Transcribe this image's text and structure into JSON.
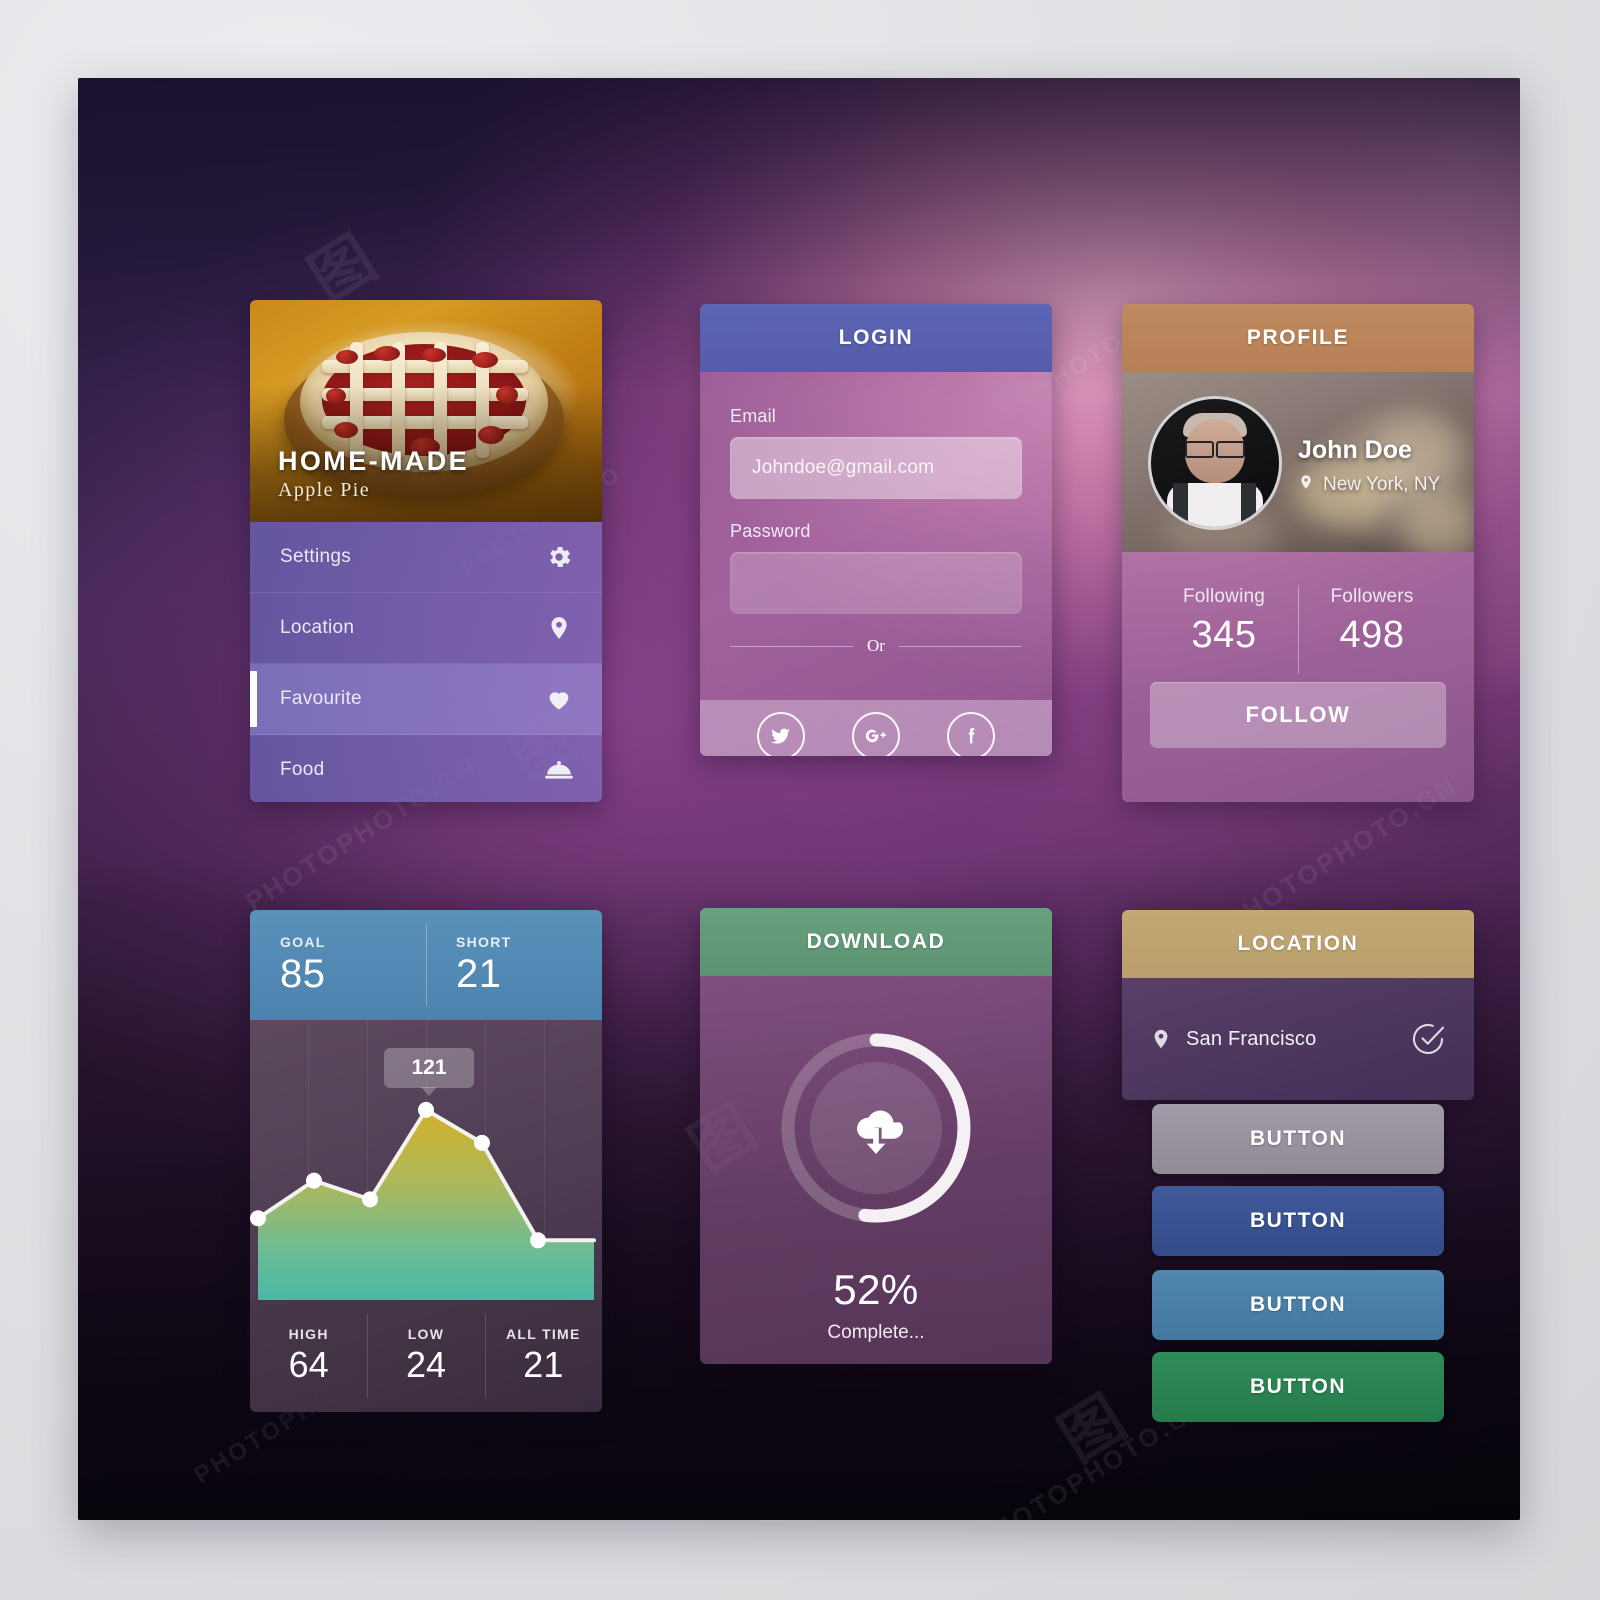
{
  "menu_card": {
    "photo_title": "HOME-MADE",
    "photo_subtitle": "Apple Pie",
    "items": [
      {
        "label": "Settings",
        "icon": "gear-icon",
        "active": false
      },
      {
        "label": "Location",
        "icon": "map-pin-icon",
        "active": false
      },
      {
        "label": "Favourite",
        "icon": "heart-icon",
        "active": true
      },
      {
        "label": "Food",
        "icon": "food-dome-icon",
        "active": false
      }
    ]
  },
  "login_card": {
    "title": "LOGIN",
    "email_label": "Email",
    "email_value": "Johndoe@gmail.com",
    "password_label": "Password",
    "password_value": "",
    "divider_text": "Or",
    "social": [
      {
        "name": "twitter-icon"
      },
      {
        "name": "google-plus-icon"
      },
      {
        "name": "facebook-icon"
      }
    ]
  },
  "profile_card": {
    "title": "PROFILE",
    "name": "John Doe",
    "location": "New York, NY",
    "stats": [
      {
        "label": "Following",
        "value": "345"
      },
      {
        "label": "Followers",
        "value": "498"
      }
    ],
    "follow_label": "FOLLOW"
  },
  "chart_card": {
    "top_stats": [
      {
        "label": "GOAL",
        "value": "85"
      },
      {
        "label": "SHORT",
        "value": "21"
      }
    ],
    "tooltip": "121",
    "bottom_stats": [
      {
        "label": "HIGH",
        "value": "64"
      },
      {
        "label": "LOW",
        "value": "24"
      },
      {
        "label": "ALL TIME",
        "value": "21"
      }
    ]
  },
  "chart_data": {
    "type": "area",
    "title": "",
    "xlabel": "",
    "ylabel": "",
    "x": [
      0,
      1,
      2,
      3,
      4,
      5,
      6
    ],
    "values": [
      52,
      76,
      64,
      121,
      100,
      38,
      38
    ],
    "point_labels": [
      null,
      null,
      null,
      "121",
      null,
      null,
      null
    ],
    "highlighted_index": 3,
    "ylim": [
      0,
      140
    ],
    "grid": true,
    "legend": "none",
    "fill_gradient_top": "#d3b12b",
    "fill_gradient_bottom": "#4db7a2",
    "line_color": "#f2f2f0",
    "point_color": "#ffffff"
  },
  "download_card": {
    "title": "DOWNLOAD",
    "icon": "cloud-download-icon",
    "percent_label": "52%",
    "percent_value": 52,
    "status": "Complete..."
  },
  "location_card": {
    "title": "LOCATION",
    "pin_icon": "map-pin-icon",
    "place": "San Francisco",
    "check_icon": "check-circle-icon"
  },
  "buttons": [
    {
      "label": "BUTTON",
      "color": "#918a97"
    },
    {
      "label": "BUTTON",
      "color": "#344b88"
    },
    {
      "label": "BUTTON",
      "color": "#44789f"
    },
    {
      "label": "BUTTON",
      "color": "#267a4c"
    }
  ],
  "watermarks": {
    "brand": "PHOTOPHOTO.CN",
    "short": "PHOTOPHOTO"
  }
}
